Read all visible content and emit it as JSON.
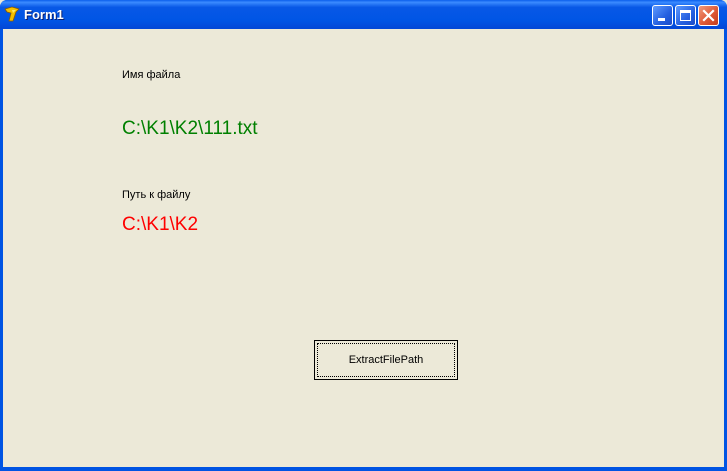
{
  "window": {
    "title": "Form1",
    "app_icon": "delphi-icon",
    "controls": {
      "minimize_icon": "minimize-icon",
      "maximize_icon": "maximize-icon",
      "close_icon": "close-icon"
    }
  },
  "form": {
    "file_name_label": "Имя файла",
    "file_name_value": "C:\\K1\\K2\\111.txt",
    "file_path_label": "Путь к файлу",
    "file_path_value": "C:\\K1\\K2",
    "button_label": "ExtractFilePath"
  },
  "colors": {
    "file_name_value": "#008000",
    "file_path_value": "#FF0000",
    "titlebar": "#0055E5",
    "client_background": "#ECE9D8"
  }
}
